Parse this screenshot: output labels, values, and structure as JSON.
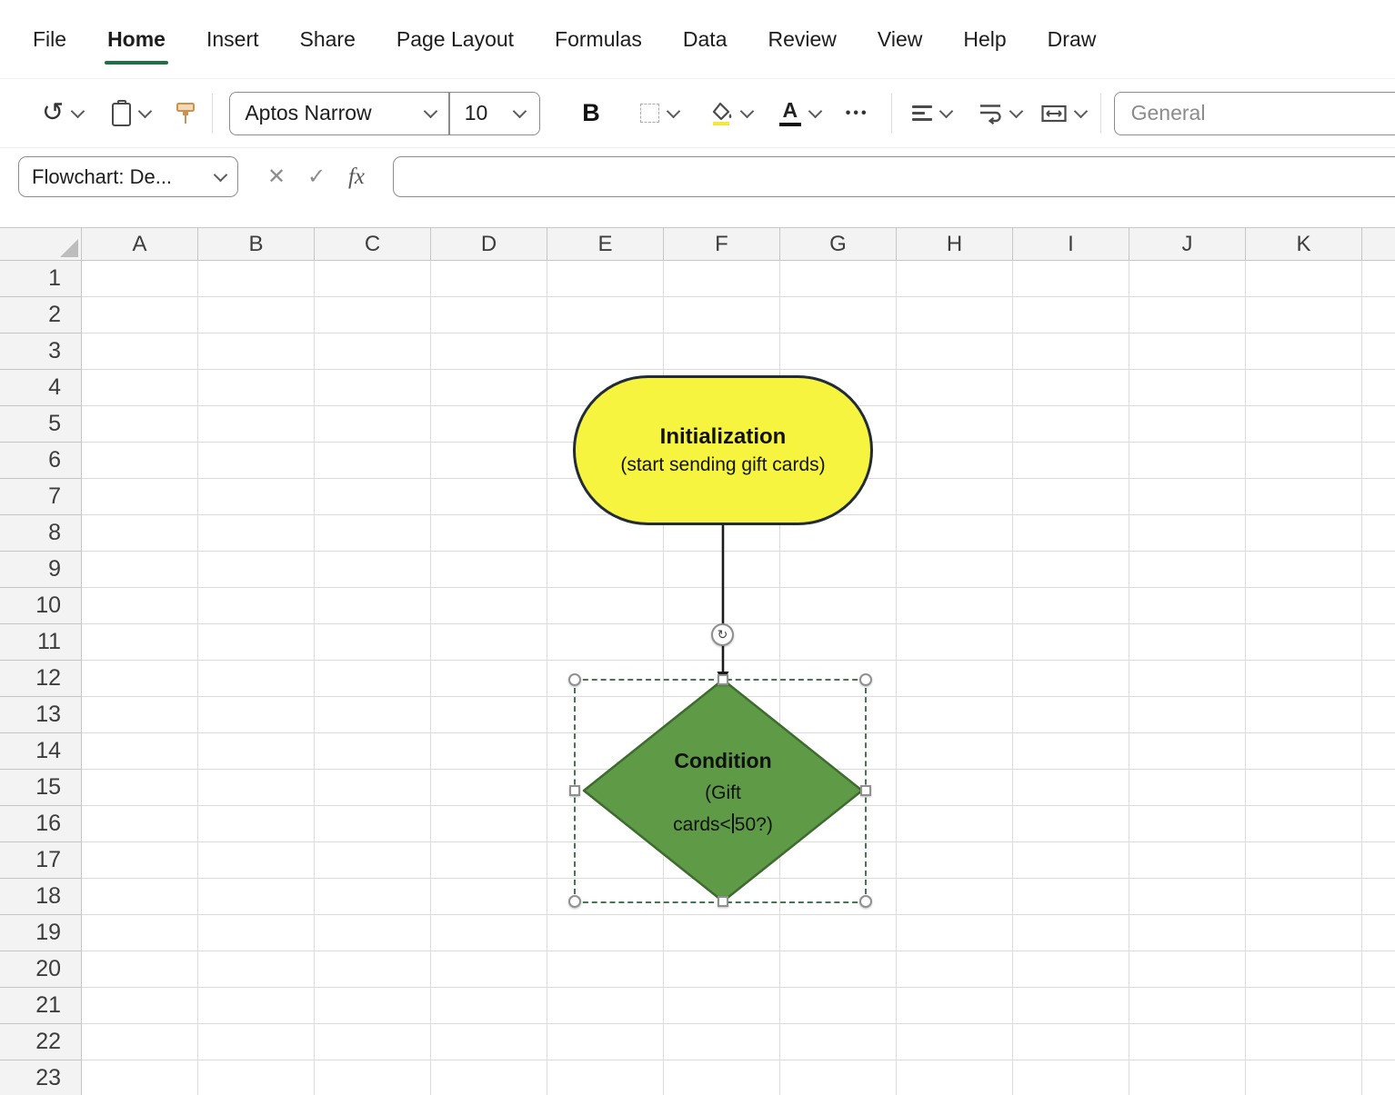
{
  "menu": {
    "items": [
      {
        "label": "File",
        "active": false
      },
      {
        "label": "Home",
        "active": true
      },
      {
        "label": "Insert",
        "active": false
      },
      {
        "label": "Share",
        "active": false
      },
      {
        "label": "Page Layout",
        "active": false
      },
      {
        "label": "Formulas",
        "active": false
      },
      {
        "label": "Data",
        "active": false
      },
      {
        "label": "Review",
        "active": false
      },
      {
        "label": "View",
        "active": false
      },
      {
        "label": "Help",
        "active": false
      },
      {
        "label": "Draw",
        "active": false
      }
    ]
  },
  "toolbar": {
    "font_name": "Aptos Narrow",
    "font_size": "10",
    "bold_label": "B",
    "number_format": "General"
  },
  "formula_bar": {
    "name_box_value": "Flowchart: De...",
    "fx_label": "fx",
    "formula_value": ""
  },
  "grid": {
    "columns": [
      "A",
      "B",
      "C",
      "D",
      "E",
      "F",
      "G",
      "H",
      "I",
      "J",
      "K"
    ],
    "row_count": 23
  },
  "flowchart": {
    "start_shape": {
      "title": "Initialization",
      "subtitle": "(start sending gift cards)",
      "fill": "#F7F440",
      "border": "#222B38"
    },
    "decision_shape": {
      "title": "Condition",
      "line2": "(Gift",
      "line3_before_caret": "cards<",
      "line3_after_caret": "50?)",
      "fill": "#5F9A47",
      "border": "#3E6B2F"
    }
  },
  "icons": {
    "undo": "↺",
    "more": "•••",
    "cancel": "✕",
    "enter": "✓",
    "rotate": "↻"
  },
  "colors": {
    "active_tab_underline": "#1E7145",
    "selection_dash": "#4A7257",
    "grid_line": "#DADADA",
    "header_bg": "#F3F3F3"
  }
}
